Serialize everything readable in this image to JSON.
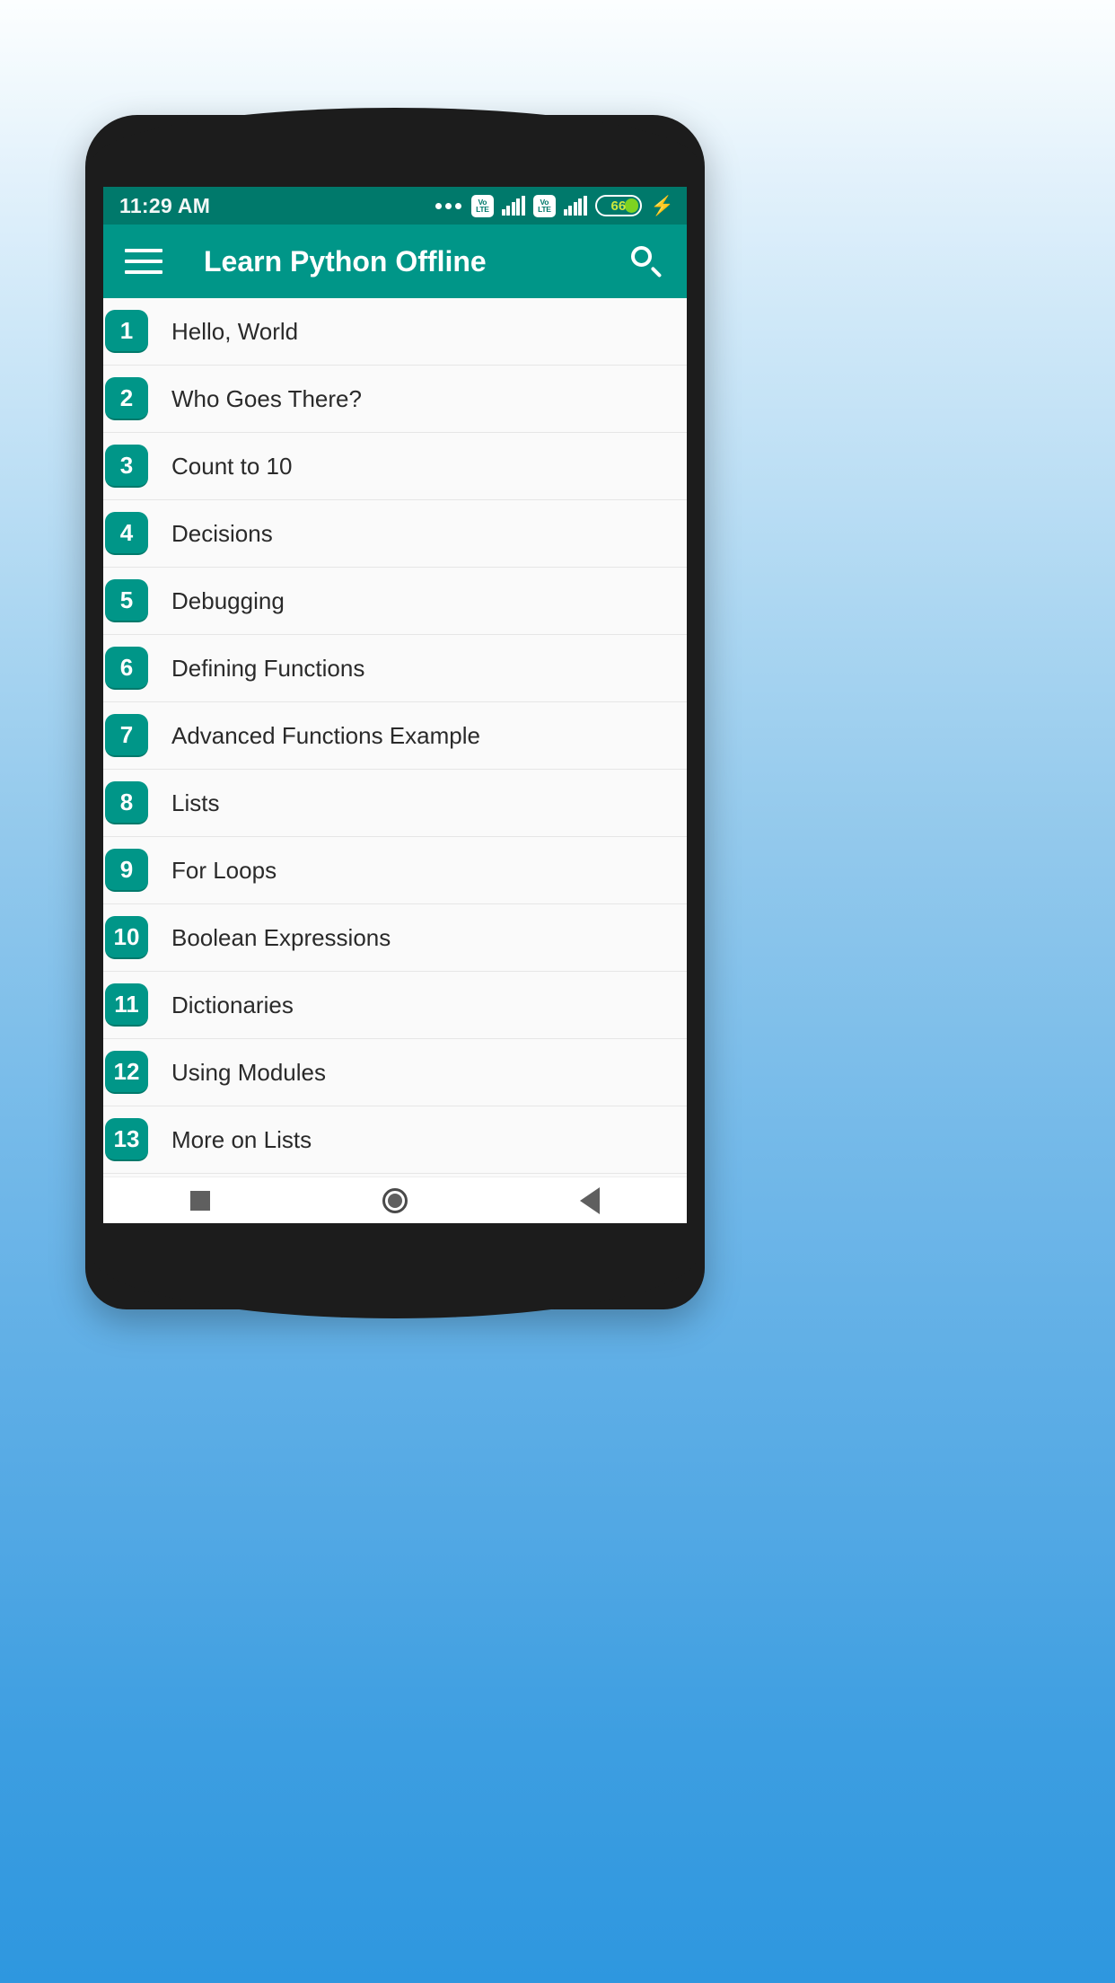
{
  "status_bar": {
    "time": "11:29 AM",
    "dots_icon": "more-dots-icon",
    "volte_top": "Vo",
    "volte_bottom": "LTE",
    "battery_percent": "66",
    "charging_icon": "lightning-bolt-icon"
  },
  "app_bar": {
    "menu_icon": "hamburger-menu-icon",
    "title": "Learn Python Offline",
    "search_icon": "search-icon"
  },
  "colors": {
    "primary": "#009688",
    "primary_dark": "#00796b",
    "background": "#fafafa",
    "battery_green": "#7ed321",
    "wallpaper_top": "#fcfeff",
    "wallpaper_bottom": "#2e97df"
  },
  "lessons": [
    {
      "number": "1",
      "title": "Hello, World"
    },
    {
      "number": "2",
      "title": "Who Goes There?"
    },
    {
      "number": "3",
      "title": "Count to 10"
    },
    {
      "number": "4",
      "title": "Decisions"
    },
    {
      "number": "5",
      "title": "Debugging"
    },
    {
      "number": "6",
      "title": "Defining Functions"
    },
    {
      "number": "7",
      "title": "Advanced Functions Example"
    },
    {
      "number": "8",
      "title": "Lists"
    },
    {
      "number": "9",
      "title": "For Loops"
    },
    {
      "number": "10",
      "title": "Boolean Expressions"
    },
    {
      "number": "11",
      "title": "Dictionaries"
    },
    {
      "number": "12",
      "title": "Using Modules"
    },
    {
      "number": "13",
      "title": "More on Lists"
    }
  ],
  "nav_bar": {
    "recents_icon": "square-recents-icon",
    "home_icon": "circle-home-icon",
    "back_icon": "triangle-back-icon"
  }
}
